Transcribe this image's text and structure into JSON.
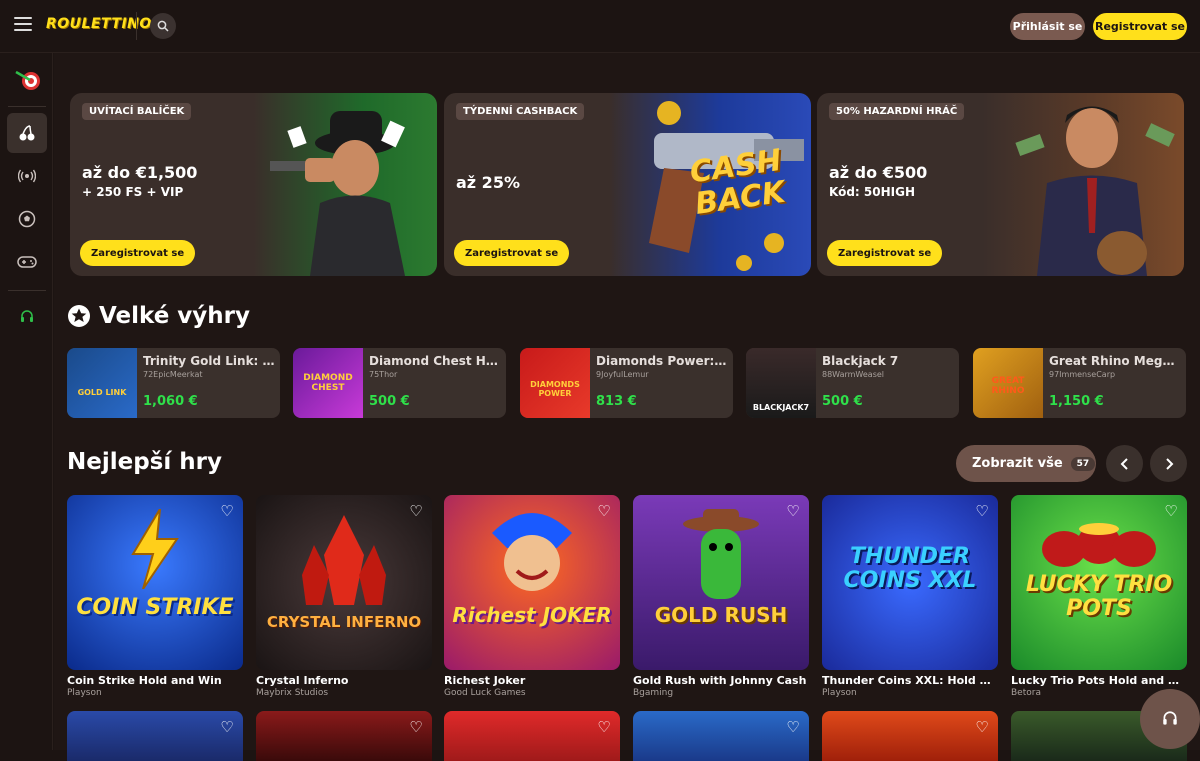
{
  "header": {
    "logo": "ROULETTINO",
    "login_label": "Přihlásit se",
    "register_label": "Registrovat se"
  },
  "promos": [
    {
      "tag": "UVÍTACÍ BALÍČEK",
      "line1": "až do €1,500",
      "line2": "+ 250 FS + VIP",
      "button": "Zaregistrovat se"
    },
    {
      "tag": "TÝDENNÍ CASHBACK",
      "line1": "až 25%",
      "line2": "",
      "button": "Zaregistrovat se",
      "art_text_1": "CASH",
      "art_text_2": "BACK"
    },
    {
      "tag": "50% HAZARDNÍ HRÁČ",
      "line1": "až do €500",
      "line2": "Kód: 50HIGH",
      "button": "Zaregistrovat se"
    }
  ],
  "big_wins": {
    "title": "Velké výhry",
    "items": [
      {
        "game": "Trinity Gold Link: Ru...",
        "user": "72EpicMeerkat",
        "amount": "1,060 €",
        "thumb_text": "GOLD LINK"
      },
      {
        "game": "Diamond Chest Hol...",
        "user": "75Thor",
        "amount": "500 €",
        "thumb_text": "DIAMOND CHEST"
      },
      {
        "game": "Diamonds Power: H...",
        "user": "9JoyfulLemur",
        "amount": "813 €",
        "thumb_text": "DIAMONDS POWER"
      },
      {
        "game": "Blackjack 7",
        "user": "88WarmWeasel",
        "amount": "500 €",
        "thumb_text": "BLACKJACK7"
      },
      {
        "game": "Great Rhino Megaw...",
        "user": "97ImmenseCarp",
        "amount": "1,150 €",
        "thumb_text": "GREAT RHINO"
      }
    ]
  },
  "top_games": {
    "title": "Nejlepší hry",
    "show_all": "Zobrazit vše",
    "count": "57",
    "items": [
      {
        "name": "Coin Strike Hold and Win",
        "provider": "Playson",
        "art": "COIN STRIKE"
      },
      {
        "name": "Crystal Inferno",
        "provider": "Maybrix Studios",
        "art": "CRYSTAL INFERNO"
      },
      {
        "name": "Richest Joker",
        "provider": "Good Luck Games",
        "art": "Richest JOKER"
      },
      {
        "name": "Gold Rush with Johnny Cash",
        "provider": "Bgaming",
        "art": "GOLD RUSH"
      },
      {
        "name": "Thunder Coins XXL: Hold an...",
        "provider": "Playson",
        "art": "THUNDER COINS XXL"
      },
      {
        "name": "Lucky Trio Pots Hold and W...",
        "provider": "Betora",
        "art": "LUCKY TRIO POTS"
      }
    ]
  }
}
